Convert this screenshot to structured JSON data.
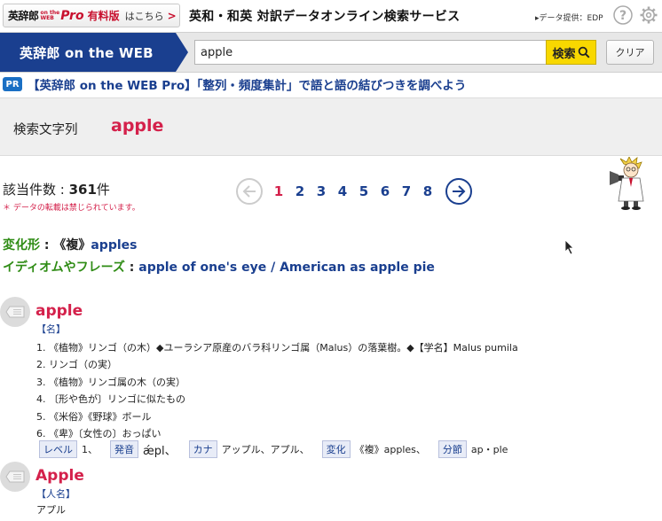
{
  "header": {
    "pro_banner": {
      "logo_text": "英辞郎",
      "logo_mini_top": "on the",
      "logo_mini_bottom": "WEB",
      "logo_pro": "Pro",
      "paid_label": "有料版",
      "here_label": "はこちら",
      "chevron": ">"
    },
    "site_title": "英和・和英 対訳データオンライン検索サービス",
    "data_provider": "▸データ提供：EDP",
    "icons": [
      "help-icon",
      "gear-icon"
    ]
  },
  "search": {
    "logo_text": "英辞郎 on the WEB",
    "query_value": "apple",
    "search_button_label": "検索",
    "clear_button_label": "クリア",
    "accent_color": "#f8d800",
    "brand_color": "#1a3f8f"
  },
  "pr": {
    "badge": "PR",
    "link_text": "【英辞郎 on the WEB Pro】「整列・頻度集計」で語と語の結びつきを調べよう"
  },
  "query_box": {
    "label": "検索文字列",
    "word": "apple"
  },
  "results": {
    "count_prefix": "該当件数 : ",
    "count_value": "361",
    "count_suffix": "件",
    "transfer_note": "＊ データの転載は禁じられています。"
  },
  "pagination": {
    "current": "1",
    "pages": [
      "1",
      "2",
      "3",
      "4",
      "5",
      "6",
      "7",
      "8"
    ]
  },
  "inflection": {
    "label": "変化形",
    "colon": " : ",
    "marker": "《複》",
    "value": "apples"
  },
  "idioms": {
    "label": "イディオムやフレーズ",
    "colon": " : ",
    "item1": "apple of one's eye",
    "separator": " / ",
    "item2": "American as apple pie"
  },
  "entries": [
    {
      "headword": "apple",
      "pos": "【名】",
      "senses": [
        "1. 《植物》リンゴ（の木）◆ユーラシア原産のバラ科リンゴ属（Malus）の落葉樹。◆【学名】Malus pumila",
        "2. リンゴ（の実）",
        "3. 《植物》リンゴ属の木（の実）",
        "4. 〔形や色が〕リンゴに似たもの",
        "5. 《米俗》《野球》ボール",
        "6. 《卑》〔女性の〕おっぱい"
      ],
      "meta": {
        "level_tag": "レベル",
        "level_val": "1、",
        "pron_tag": "発音",
        "pron_val": "ǽpl、",
        "kana_tag": "カナ",
        "kana_val": "アップル、アプル、",
        "inflection_tag": "変化",
        "inflection_val": "《複》apples、",
        "syllable_tag": "分節",
        "syllable_val": "ap・ple"
      }
    },
    {
      "headword": "Apple",
      "pos": "【人名】",
      "text": "アプル"
    }
  ]
}
